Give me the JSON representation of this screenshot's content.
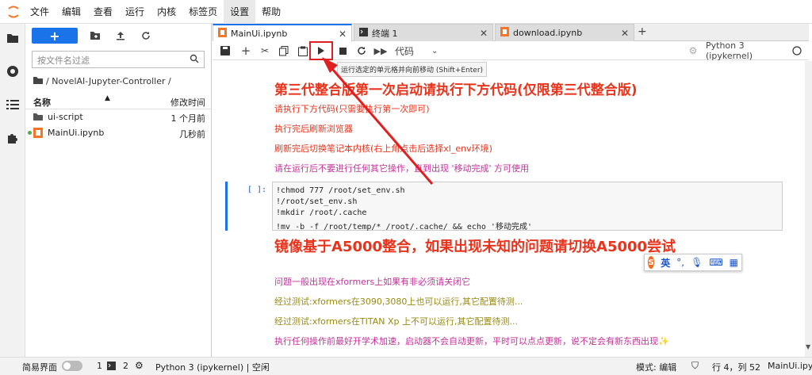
{
  "menu": {
    "items": [
      "文件",
      "编辑",
      "查看",
      "运行",
      "内核",
      "标签页",
      "设置",
      "帮助"
    ],
    "active_index": 6
  },
  "filebrowser": {
    "filter_placeholder": "按文件名过滤",
    "path": "/ NovelAI-Jupyter-Controller /",
    "col_name": "名称",
    "col_modified": "修改时间",
    "files": [
      {
        "name": "ui-script",
        "modified": "1 个月前",
        "type": "folder"
      },
      {
        "name": "MainUi.ipynb",
        "modified": "几秒前",
        "type": "notebook"
      }
    ]
  },
  "tabs": [
    {
      "label": "MainUi.ipynb",
      "active": true
    },
    {
      "label": "终端 1",
      "active": false
    },
    {
      "label": "download.ipynb",
      "active": false
    }
  ],
  "toolbar": {
    "cell_type": "代码",
    "kernel_name": "Python 3 (ipykernel)",
    "tooltip": "运行选定的单元格并向前移动 (Shift+Enter)"
  },
  "notebook": {
    "h1": "第三代整合版第一次启动请执行下方代码(仅限第三代整合版)",
    "p1": "请执行下方代码(只需要执行第一次即可)",
    "p2": "执行完后刷新浏览器",
    "p3": "刷新完后切换笔记本内核(右上角点击后选择xl_env环境)",
    "p4": "请在运行后不要进行任何其它操作，直到出现 '移动完成' 方可使用",
    "prompt": "[ ]:",
    "code": [
      "!chmod 777 /root/set_env.sh",
      "!/root/set_env.sh",
      "!mkdir /root/.cache",
      "!mv -b -f /root/temp/* /root/.cache/ && echo '移动完成'"
    ],
    "h2": "镜像基于A5000整合，如果出现未知的问题请切换A5000尝试",
    "p5": "问题一般出现在xformers上如果有非必须请关闭它",
    "p6": "经过测试:xformers在3090,3080上也可以运行,其它配置待测...",
    "p7": "经过测试:xformers在TITAN Xp 上不可以运行,其它配置待测...",
    "p8": "执行任何操作前最好开学术加速，启动器不会自动更新，平时可以点点更新，说不定会有新东西出现✨"
  },
  "ime": {
    "label": "英"
  },
  "statusbar": {
    "simple_mode": "简易界面",
    "count1": "1",
    "count2": "2",
    "kernel_status": "Python 3 (ipykernel) | 空闲",
    "mode": "模式: 编辑",
    "position": "行 4，列 52",
    "filename": "MainUi.ipynb"
  },
  "colors": {
    "accent": "#1a73e8",
    "heading_red": "#e8341c",
    "text_magenta": "#c4309b",
    "text_olive": "#9a8a10",
    "annotation_red": "#e02020"
  }
}
